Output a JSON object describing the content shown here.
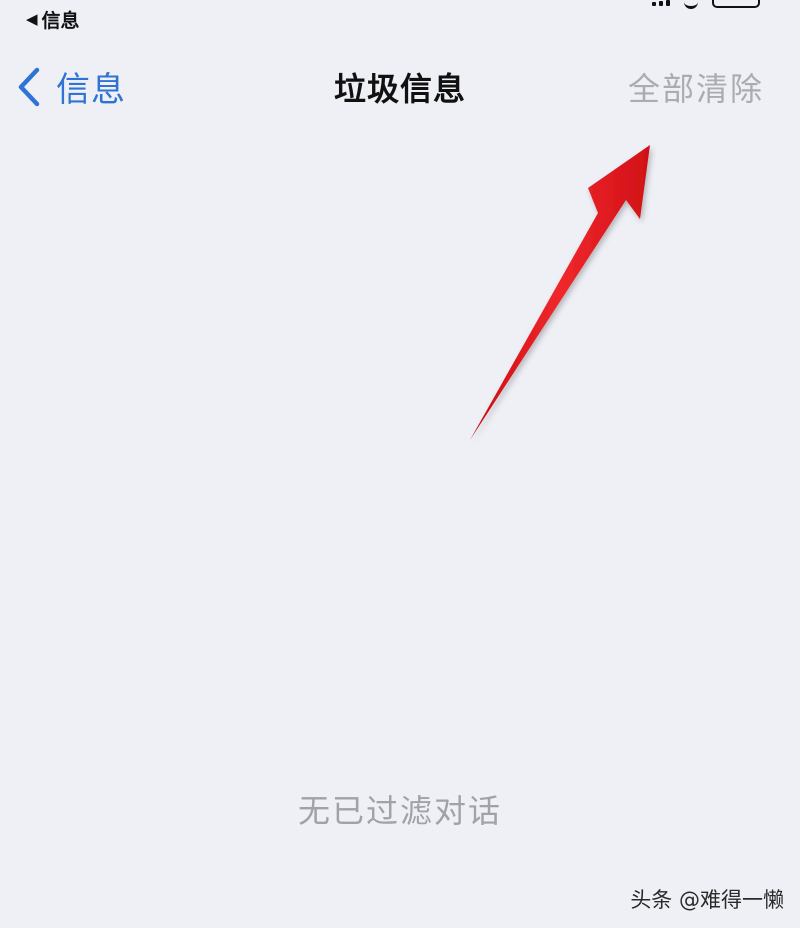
{
  "status_bar": {
    "back_label": "信息",
    "back_icon": "triangle-left-icon"
  },
  "nav": {
    "back_label": "信息",
    "title": "垃圾信息",
    "clear_all_label": "全部清除"
  },
  "empty_state": {
    "message": "无已过滤对话"
  },
  "watermark": {
    "text": "头条 @难得一懒"
  },
  "colors": {
    "background": "#eef0f6",
    "accent": "#2f73d4",
    "disabled_text": "#a9acb2",
    "arrow": "#e8181c"
  }
}
